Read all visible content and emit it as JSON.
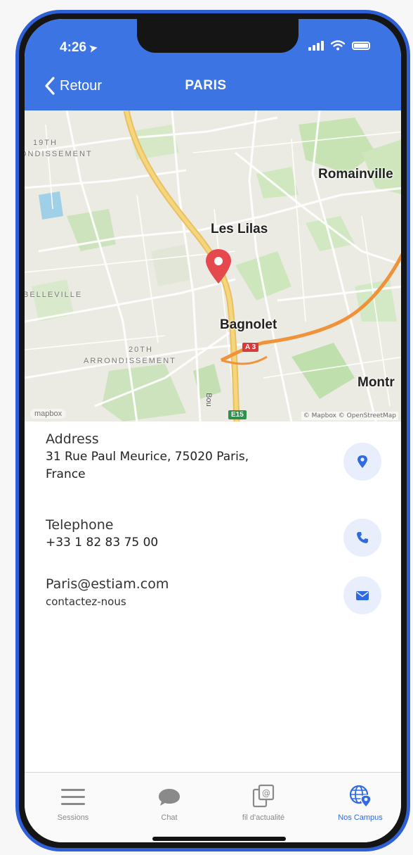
{
  "status_bar": {
    "time": "4:26"
  },
  "header": {
    "back_label": "Retour",
    "title": "PARIS"
  },
  "map": {
    "labels": {
      "arr19": "19TH",
      "arr19b": "ONDISSEMENT",
      "romainville": "Romainville",
      "les_lilas": "Les Lilas",
      "belleville": "BELLEVILLE",
      "bagnolet": "Bagnolet",
      "arr20": "20TH",
      "arr20b": "ARRONDISSEMENT",
      "montreuil": "Montr",
      "bou": "Bou"
    },
    "shields": {
      "a3": "A 3",
      "e15": "E15"
    },
    "logo": "mapbox",
    "attribution": "© Mapbox © OpenStreetMap"
  },
  "contact": {
    "address_label": "Address",
    "address_line1": "31 Rue Paul Meurice, 75020 Paris,",
    "address_line2": "France",
    "telephone_label": "Telephone",
    "telephone_value": "+33 1 82 83 75 00",
    "email_value": "Paris@estiam.com",
    "email_sub": "contactez-nous"
  },
  "tabbar": {
    "tabs": [
      {
        "label": "Sessions",
        "icon": "menu-icon"
      },
      {
        "label": "Chat",
        "icon": "chat-bubble-icon"
      },
      {
        "label": "fil d'actualité",
        "icon": "news-feed-icon"
      },
      {
        "label": "Nos Campus",
        "icon": "globe-pin-icon"
      }
    ],
    "active_color": "#2f6be0"
  },
  "colors": {
    "header": "#3d74e3",
    "accent": "#2f6be0",
    "pin": "#e5484d",
    "icon_circle": "#e8eefb"
  }
}
